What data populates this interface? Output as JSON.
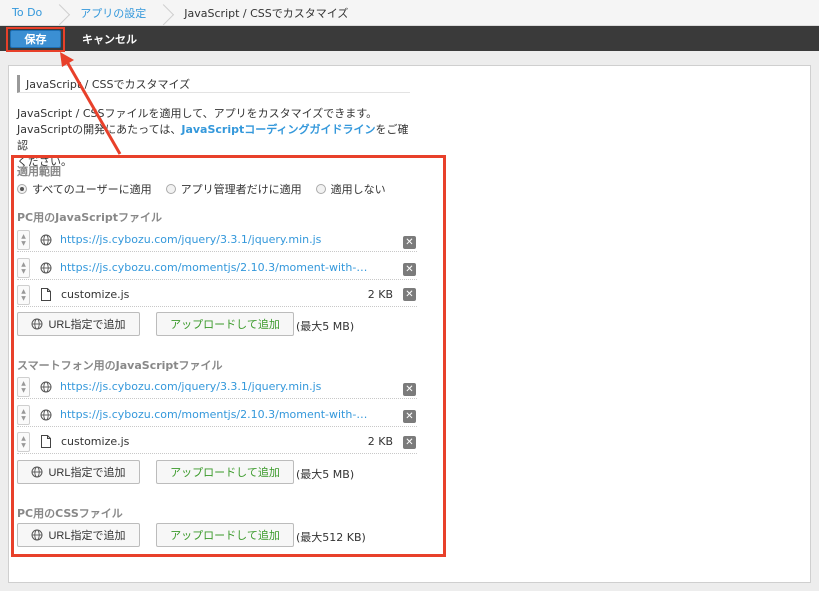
{
  "breadcrumb": {
    "items": [
      "To Do",
      "アプリの設定",
      "JavaScript / CSSでカスタマイズ"
    ]
  },
  "toolbar": {
    "save_label": "保存",
    "cancel_label": "キャンセル"
  },
  "section": {
    "title": "JavaScript / CSSでカスタマイズ",
    "desc_line1": "JavaScript / CSSファイルを適用して、アプリをカスタマイズできます。",
    "desc_line2_pre": "JavaScriptの開発にあたっては、",
    "desc_line2_link": "JavaScriptコーディングガイドライン",
    "desc_line2_post": "をご確認",
    "desc_line3": "ください。"
  },
  "scope": {
    "label": "適用範囲",
    "options": [
      "すべてのユーザーに適用",
      "アプリ管理者だけに適用",
      "適用しない"
    ],
    "selected": "すべてのユーザーに適用"
  },
  "pc_js": {
    "label": "PC用のJavaScriptファイル",
    "files": [
      {
        "url": "https://js.cybozu.com/jquery/3.3.1/jquery.min.js"
      },
      {
        "url": "https://js.cybozu.com/momentjs/2.10.3/moment-with-locale…"
      },
      {
        "name": "customize.js",
        "size": "2 KB"
      }
    ],
    "url_button": "URL指定で追加",
    "upload_button": "アップロードして追加",
    "max_note": "(最大5 MB)"
  },
  "sp_js": {
    "label": "スマートフォン用のJavaScriptファイル",
    "files": [
      {
        "url": "https://js.cybozu.com/jquery/3.3.1/jquery.min.js"
      },
      {
        "url": "https://js.cybozu.com/momentjs/2.10.3/moment-with-locale…"
      },
      {
        "name": "customize.js",
        "size": "2 KB"
      }
    ],
    "url_button": "URL指定で追加",
    "upload_button": "アップロードして追加",
    "max_note": "(最大5 MB)"
  },
  "pc_css": {
    "label": "PC用のCSSファイル",
    "url_button": "URL指定で追加",
    "upload_button": "アップロードして追加",
    "max_note": "(最大512 KB)"
  },
  "colors": {
    "accent": "#3b8fd3",
    "highlight": "#e8402a",
    "link": "#3498db",
    "upload_text": "#3a9a2a"
  }
}
